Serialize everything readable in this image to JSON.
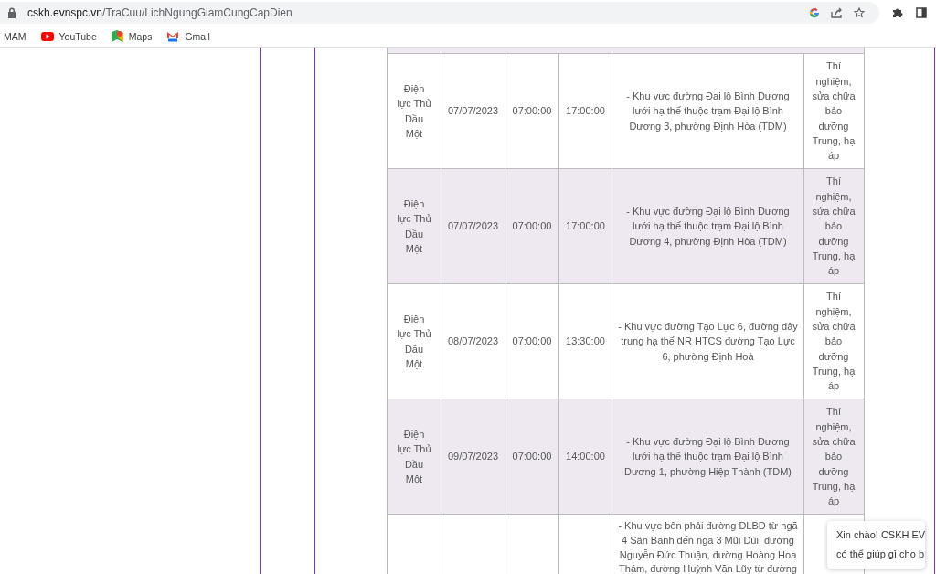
{
  "browser": {
    "url_host": "cskh.evnspc.vn",
    "url_path": "/TraCuu/LichNgungGiamCungCapDien"
  },
  "bookmarks": [
    {
      "label": "MAM"
    },
    {
      "label": "YouTube"
    },
    {
      "label": "Maps"
    },
    {
      "label": "Gmail"
    }
  ],
  "table": {
    "rows": [
      {
        "unit": "Điện lực Thủ Dầu Một",
        "date": "07/07/2023",
        "start": "07:00:00",
        "end": "17:00:00",
        "area": "- Khu vực đường Đại lộ Bình Dương lưới hạ thế thuộc trạm Đại lộ Bình Dương 3, phường Định Hòa (TDM)",
        "reason": "Thí nghiệm, sửa chữa bảo dưỡng Trung, hạ áp"
      },
      {
        "unit": "Điện lực Thủ Dầu Một",
        "date": "07/07/2023",
        "start": "07:00:00",
        "end": "17:00:00",
        "area": "- Khu vực đường Đại lộ Bình Dương lưới hạ thế thuộc trạm Đại lộ Bình Dương 4, phường Định Hòa (TDM)",
        "reason": "Thí nghiệm, sửa chữa bảo dưỡng Trung, hạ áp"
      },
      {
        "unit": "Điện lực Thủ Dầu Một",
        "date": "08/07/2023",
        "start": "07:00:00",
        "end": "13:30:00",
        "area": "- Khu vực đường Tạo Lực 6, đường dây trung hạ thế NR HTCS đường Tạo Lực 6, phường Định Hoà",
        "reason": "Thí nghiệm, sửa chữa bảo dưỡng Trung, hạ áp"
      },
      {
        "unit": "Điện lực Thủ Dầu Một",
        "date": "09/07/2023",
        "start": "07:00:00",
        "end": "14:00:00",
        "area": "- Khu vực đường Đại lộ Bình Dương lưới hạ thế thuộc trạm Đại lộ Bình Dương 1, phường Hiệp Thành (TDM)",
        "reason": "Thí nghiệm, sửa chữa bảo dưỡng Trung, hạ áp"
      },
      {
        "area": "- Khu vực bên phải đường ĐLBD từ ngã 4 Sân Banh đến ngã 3 Mũi Dùi, đường Nguyễn Đức Thuận, đường Hoàng Hoa Thám, đường Huỳnh Văn Lũy từ đường"
      }
    ]
  },
  "chat_bubble": {
    "lines": [
      "Xin chào! CSKH EV",
      "có thể giúp gì cho b"
    ]
  }
}
